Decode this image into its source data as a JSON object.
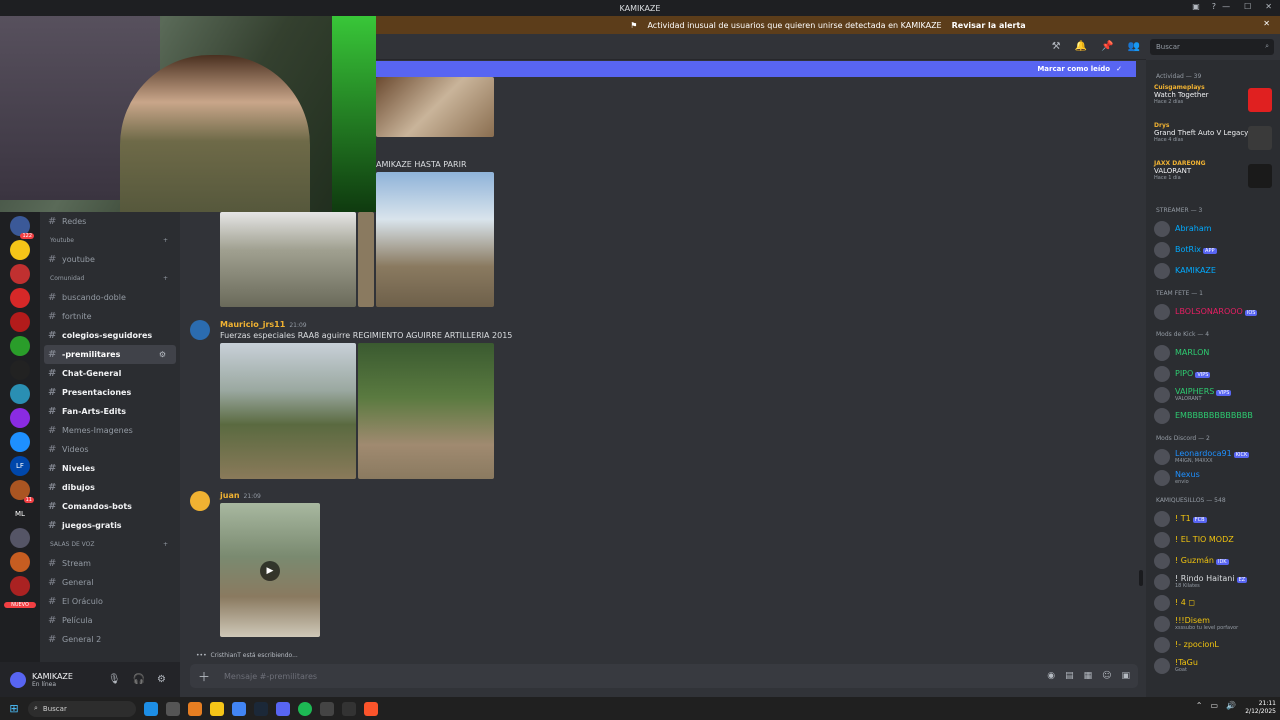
{
  "titlebar": {
    "title": "KAMIKAZE"
  },
  "alert": {
    "text": "Actividad inusual de usuarios que quieren unirse detectada en KAMIKAZE",
    "link": "Revisar la alerta"
  },
  "banner": {
    "text": "Marcar como leído"
  },
  "search": {
    "placeholder": "Buscar"
  },
  "servers": [
    {
      "label": "",
      "badge": "122",
      "color": "#3b5998"
    },
    {
      "label": "",
      "badge": "",
      "color": "#f5c518"
    },
    {
      "label": "",
      "badge": "",
      "color": "#c03030"
    },
    {
      "label": "",
      "badge": "",
      "color": "#d62828"
    },
    {
      "label": "",
      "badge": "",
      "color": "#b31b1b"
    },
    {
      "label": "",
      "badge": "",
      "color": "#2a9d2a"
    },
    {
      "label": "",
      "badge": "",
      "color": "#222"
    },
    {
      "label": "",
      "badge": "",
      "color": "#2a8fb3"
    },
    {
      "label": "",
      "badge": "",
      "color": "#8a2be2"
    },
    {
      "label": "",
      "badge": "",
      "color": "#1e90ff"
    },
    {
      "label": "LF",
      "badge": "",
      "color": "#0047ab"
    },
    {
      "label": "",
      "badge": "11",
      "color": "#aa5522"
    },
    {
      "label": "ML",
      "badge": "",
      "color": "#1e1f22"
    },
    {
      "label": "",
      "badge": "",
      "color": "#556"
    },
    {
      "label": "",
      "badge": "",
      "color": "#c65d21"
    },
    {
      "label": "",
      "badge": "",
      "color": "#aa2222"
    }
  ],
  "new_badge": "NUEVO",
  "channels": [
    {
      "type": "ch",
      "label": "Redes",
      "bold": false
    },
    {
      "type": "cat",
      "label": "Youtube"
    },
    {
      "type": "ch",
      "label": "youtube",
      "bold": false
    },
    {
      "type": "cat",
      "label": "Comunidad"
    },
    {
      "type": "ch",
      "label": "buscando-doble",
      "bold": false
    },
    {
      "type": "ch",
      "label": "fortnite",
      "bold": false
    },
    {
      "type": "ch",
      "label": "colegios-seguidores",
      "bold": true
    },
    {
      "type": "ch",
      "label": "-premilitares",
      "bold": true,
      "active": true
    },
    {
      "type": "ch",
      "label": "Chat-General",
      "bold": true
    },
    {
      "type": "ch",
      "label": "Presentaciones",
      "bold": true
    },
    {
      "type": "ch",
      "label": "Fan-Arts-Edits",
      "bold": true
    },
    {
      "type": "ch",
      "label": "Memes-Imagenes",
      "bold": false
    },
    {
      "type": "ch",
      "label": "Videos",
      "bold": false
    },
    {
      "type": "ch",
      "label": "Niveles",
      "bold": true
    },
    {
      "type": "ch",
      "label": "dibujos",
      "bold": true
    },
    {
      "type": "ch",
      "label": "Comandos-bots",
      "bold": true
    },
    {
      "type": "ch",
      "label": "juegos-gratis",
      "bold": true
    },
    {
      "type": "cat",
      "label": "SALAS DE VOZ"
    },
    {
      "type": "ch",
      "label": "Stream",
      "bold": false
    },
    {
      "type": "ch",
      "label": "General",
      "bold": false
    },
    {
      "type": "ch",
      "label": "El Oráculo",
      "bold": false
    },
    {
      "type": "ch",
      "label": "Película",
      "bold": false
    },
    {
      "type": "ch",
      "label": "General 2",
      "bold": false
    }
  ],
  "user": {
    "name": "KAMIKAZE",
    "status": "En línea"
  },
  "messages": [
    {
      "caption": "AMIKAZE HASTA PARIR"
    },
    {
      "author": "Mauricio_jrs11",
      "time": "21:09",
      "text": "Fuerzas especiales RAA8 aguirre  REGIMIENTO AGUIRRE ARTILLERIA 2015"
    },
    {
      "author": "juan",
      "time": "21:09"
    }
  ],
  "typing": "CristhianT está escribiendo...",
  "composer": {
    "placeholder": "Mensaje #-premilitares"
  },
  "activity": {
    "header": "Actividad — 39",
    "items": [
      {
        "who": "Cuisgameplays",
        "what": "Watch Together",
        "when": "Hace 2 días",
        "color": "#e02020"
      },
      {
        "who": "Drys",
        "what": "Grand Theft Auto V Legacy",
        "when": "Hace 4 días",
        "color": "#3a3a3a"
      },
      {
        "who": "JAXX DAREONG",
        "what": "VALORANT",
        "when": "Hace 1 día",
        "color": "#1a1a1a"
      }
    ]
  },
  "members": [
    {
      "section": "STREAMER — 3",
      "list": [
        {
          "name": "Abraham",
          "color": "#00aaff",
          "sub": ""
        },
        {
          "name": "BotRix",
          "color": "#00aaff",
          "sub": "",
          "tag": "APP"
        },
        {
          "name": "KAMIKAZE",
          "color": "#00aaff",
          "sub": ""
        }
      ]
    },
    {
      "section": "TEAM FETE — 1",
      "list": [
        {
          "name": "LBOLSONAROOO",
          "color": "#e91e63",
          "sub": "",
          "tag": "IOS"
        }
      ]
    },
    {
      "section": "Mods de Kick — 4",
      "list": [
        {
          "name": "MARLON",
          "color": "#2ecc71",
          "sub": ""
        },
        {
          "name": "PIPO",
          "color": "#2ecc71",
          "sub": "",
          "tag": "VIPS"
        },
        {
          "name": "VAIPHERS",
          "color": "#2ecc71",
          "sub": "VALORANT",
          "tag": "VIPS"
        },
        {
          "name": "EMBBBBBBBBBBBB",
          "color": "#2ecc71",
          "sub": ""
        }
      ]
    },
    {
      "section": "Mods Discord — 2",
      "list": [
        {
          "name": "Leonardoca91",
          "color": "#1e90ff",
          "sub": "M4IGN, M4XXX",
          "tag": "KICK"
        },
        {
          "name": "Nexus",
          "color": "#1e90ff",
          "sub": "envio"
        }
      ]
    },
    {
      "section": "KAMIQUESILLOS — 548",
      "list": [
        {
          "name": "! T1",
          "color": "#f1c40f",
          "sub": "",
          "tag": "FCB"
        },
        {
          "name": "! EL TIO MODZ",
          "color": "#f1c40f",
          "sub": ""
        },
        {
          "name": "! Guzmán",
          "color": "#f1c40f",
          "sub": "",
          "tag": "IDK"
        },
        {
          "name": "! Rindo Haitani",
          "color": "#dbdee1",
          "sub": "18 Kilates",
          "tag": "EZ"
        },
        {
          "name": "! 4 ◻",
          "color": "#f1c40f",
          "sub": ""
        },
        {
          "name": "!!!Disem",
          "color": "#f1c40f",
          "sub": "xsssubo tu level porfavor"
        },
        {
          "name": "!- zpocionL",
          "color": "#f1c40f",
          "sub": ""
        },
        {
          "name": "!TaGu",
          "color": "#f1c40f",
          "sub": "Goat"
        }
      ]
    }
  ],
  "taskbar": {
    "search": "Buscar",
    "time": "21:11",
    "date": "2/12/2025"
  }
}
